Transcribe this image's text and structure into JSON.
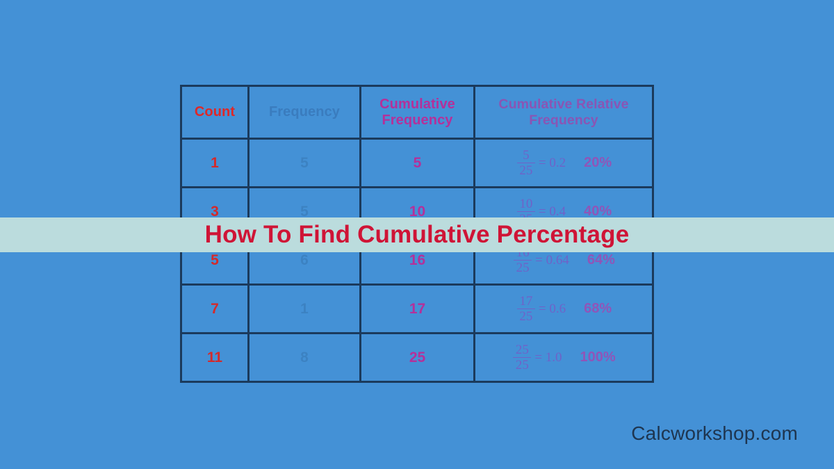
{
  "page": {
    "background_color": "#4491d6",
    "border_color": "#1b3a5c"
  },
  "banner": {
    "title": "How To Find Cumulative Percentage",
    "background_color": "#bbdcdd",
    "text_color": "#cf1436"
  },
  "watermark": {
    "text": "Calcworkshop.com",
    "color": "#1e3550"
  },
  "table": {
    "headers": [
      {
        "label": "Count",
        "color": "#de2828"
      },
      {
        "label": "Frequency",
        "color": "#3a7cbe"
      },
      {
        "label": "Cumulative Frequency",
        "color": "#b5309a"
      },
      {
        "label": "Cumulative Relative Frequency",
        "color": "#8a55b4"
      }
    ],
    "rows": [
      {
        "count": "1",
        "frequency": "5",
        "cumulative_frequency": "5",
        "fraction_numerator": "5",
        "fraction_denominator": "25",
        "fraction_equals": "= 0.2",
        "percent": "20%"
      },
      {
        "count": "3",
        "frequency": "5",
        "cumulative_frequency": "10",
        "fraction_numerator": "10",
        "fraction_denominator": "25",
        "fraction_equals": "= 0.4",
        "percent": "40%"
      },
      {
        "count": "5",
        "frequency": "6",
        "cumulative_frequency": "16",
        "fraction_numerator": "16",
        "fraction_denominator": "25",
        "fraction_equals": "= 0.64",
        "percent": "64%"
      },
      {
        "count": "7",
        "frequency": "1",
        "cumulative_frequency": "17",
        "fraction_numerator": "17",
        "fraction_denominator": "25",
        "fraction_equals": "= 0.6",
        "percent": "68%"
      },
      {
        "count": "11",
        "frequency": "8",
        "cumulative_frequency": "25",
        "fraction_numerator": "25",
        "fraction_denominator": "25",
        "fraction_equals": "= 1.0",
        "percent": "100%"
      }
    ]
  },
  "chart_data": {
    "type": "table",
    "title": "How To Find Cumulative Percentage",
    "columns": [
      "Count",
      "Frequency",
      "Cumulative Frequency",
      "Cumulative Relative Frequency"
    ],
    "counts": [
      1,
      3,
      5,
      7,
      11
    ],
    "frequencies": [
      5,
      5,
      6,
      1,
      8
    ],
    "cumulative_frequencies": [
      5,
      10,
      16,
      17,
      25
    ],
    "cumulative_relative_frequencies": [
      0.2,
      0.4,
      0.64,
      0.6,
      1.0
    ],
    "cumulative_percentages": [
      "20%",
      "40%",
      "64%",
      "68%",
      "100%"
    ],
    "total": 25
  }
}
